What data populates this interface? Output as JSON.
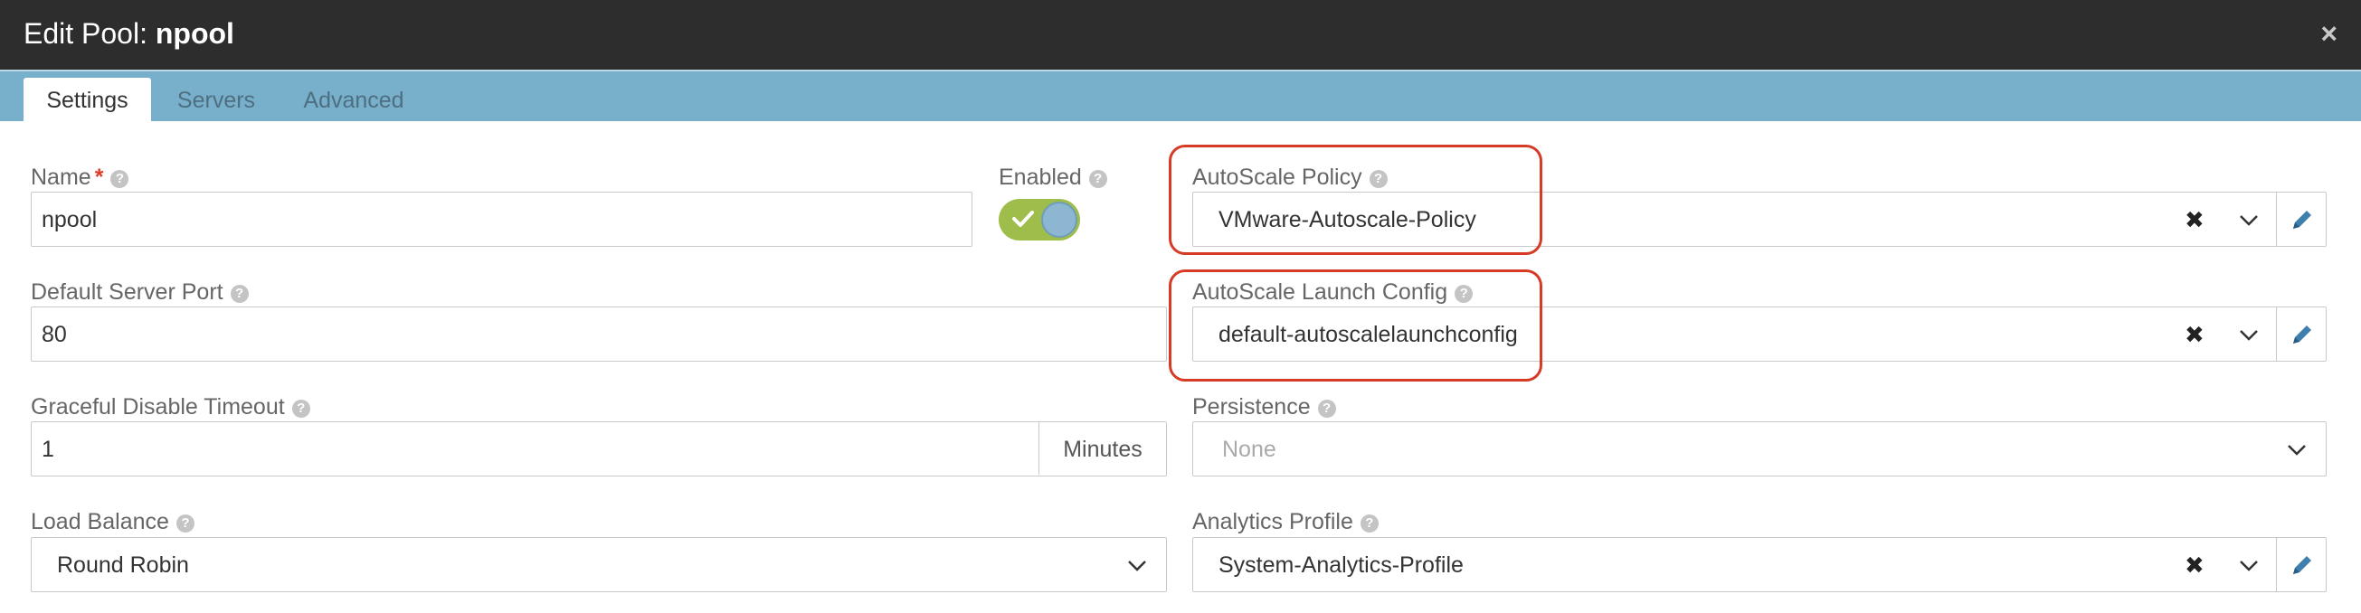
{
  "dialog": {
    "title_prefix": "Edit Pool: ",
    "title_name": "npool",
    "close_label": "×"
  },
  "tabs": [
    {
      "label": "Settings",
      "active": true
    },
    {
      "label": "Servers",
      "active": false
    },
    {
      "label": "Advanced",
      "active": false
    }
  ],
  "form": {
    "name": {
      "label": "Name",
      "required_mark": "*",
      "value": "npool"
    },
    "enabled": {
      "label": "Enabled",
      "on": true
    },
    "autoscale_policy": {
      "label": "AutoScale Policy",
      "value": "VMware-Autoscale-Policy"
    },
    "default_server_port": {
      "label": "Default Server Port",
      "value": "80"
    },
    "autoscale_launch_config": {
      "label": "AutoScale Launch Config",
      "value": "default-autoscalelaunchconfig"
    },
    "graceful_disable_timeout": {
      "label": "Graceful Disable Timeout",
      "value": "1",
      "unit": "Minutes"
    },
    "persistence": {
      "label": "Persistence",
      "placeholder": "None"
    },
    "load_balance": {
      "label": "Load Balance",
      "value": "Round Robin"
    },
    "analytics_profile": {
      "label": "Analytics Profile",
      "value": "System-Analytics-Profile"
    }
  },
  "colors": {
    "titlebar": "#2d2d2d",
    "tabbar": "#78b0cc",
    "highlight": "#d63b26",
    "toggle_on": "#9ebd4a",
    "required": "#e03c2a"
  },
  "icons": {
    "help": "?",
    "clear": "✖",
    "dropdown": "chevron-down",
    "edit": "pencil",
    "check": "checkmark"
  }
}
